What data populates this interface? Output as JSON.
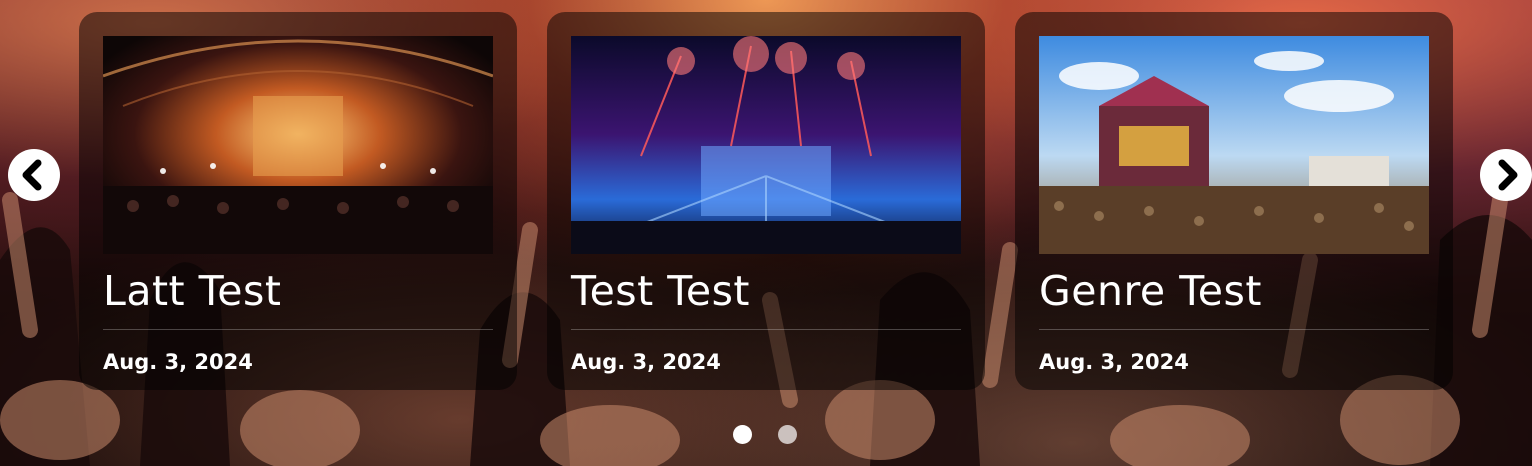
{
  "carousel": {
    "slides": [
      {
        "title": "Latt Test",
        "date": "Aug. 3, 2024",
        "image": "indoor-arena-stage-photo"
      },
      {
        "title": "Test Test",
        "date": "Aug. 3, 2024",
        "image": "fireworks-stage-photo"
      },
      {
        "title": "Genre Test",
        "date": "Aug. 3, 2024",
        "image": "outdoor-festival-stage-photo"
      }
    ],
    "prev_icon": "chevron-left-icon",
    "next_icon": "chevron-right-icon",
    "pagination": {
      "count": 2,
      "active_index": 0
    }
  },
  "colors": {
    "card_overlay": "rgba(0,0,0,0.5)",
    "text": "#ffffff",
    "dot_active": "#ffffff",
    "dot_inactive": "#d9d9d9"
  }
}
